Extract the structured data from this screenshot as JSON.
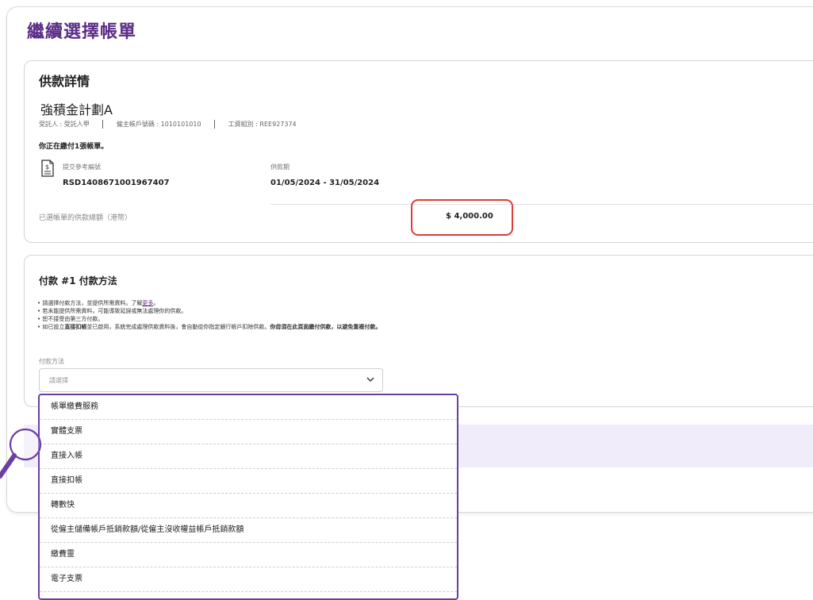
{
  "page": {
    "title": "繼續選擇帳單"
  },
  "details": {
    "section_title": "供款詳情",
    "plan_name": "強積金計劃A",
    "trustee": "受託人 : 受託人甲",
    "employer_account": "僱主帳戶號碼 : 1010101010",
    "payroll_group": "工資組別 : REE927374",
    "notice": "你正在繳付1張帳單。",
    "ref_label": "提交參考編號",
    "ref_value": "RSD1408671001967407",
    "period_label": "供款期",
    "period_value": "01/05/2024 - 31/05/2024",
    "total_label": "已選帳單的供款總額（港幣）",
    "total_value": "$ 4,000.00"
  },
  "payment": {
    "section_title": "付款 #1 付款方法",
    "bullet1_pre": "請選擇付款方法，並提供所需資料。了解",
    "bullet1_link": "更多",
    "bullet1_post": "。",
    "bullet2": "若未能提供所需資料，可能導致延誤或無法處理你的供款。",
    "bullet3": "恕不接受由第三方付款。",
    "bullet4_a": "如已設立",
    "bullet4_b": "直接扣帳",
    "bullet4_c": "並已啟用，系統完成處理供款資料後，會自動從你指定銀行帳戶扣除供款。",
    "bullet4_d": "你毋須在此頁面繳付供款，以避免重複付款。",
    "field_label": "付款方法",
    "placeholder": "請選擇"
  },
  "dropdown": {
    "options": [
      "帳單繳費服務",
      "實體支票",
      "直接入帳",
      "直接扣帳",
      "轉數快",
      "從僱主儲備帳戶抵銷款額/從僱主沒收權益帳戶抵銷款額",
      "繳費靈",
      "電子支票"
    ]
  },
  "colors": {
    "brand": "#5b2d86",
    "highlight": "#e03b3b",
    "dropdown_border": "#6a3fa0"
  }
}
